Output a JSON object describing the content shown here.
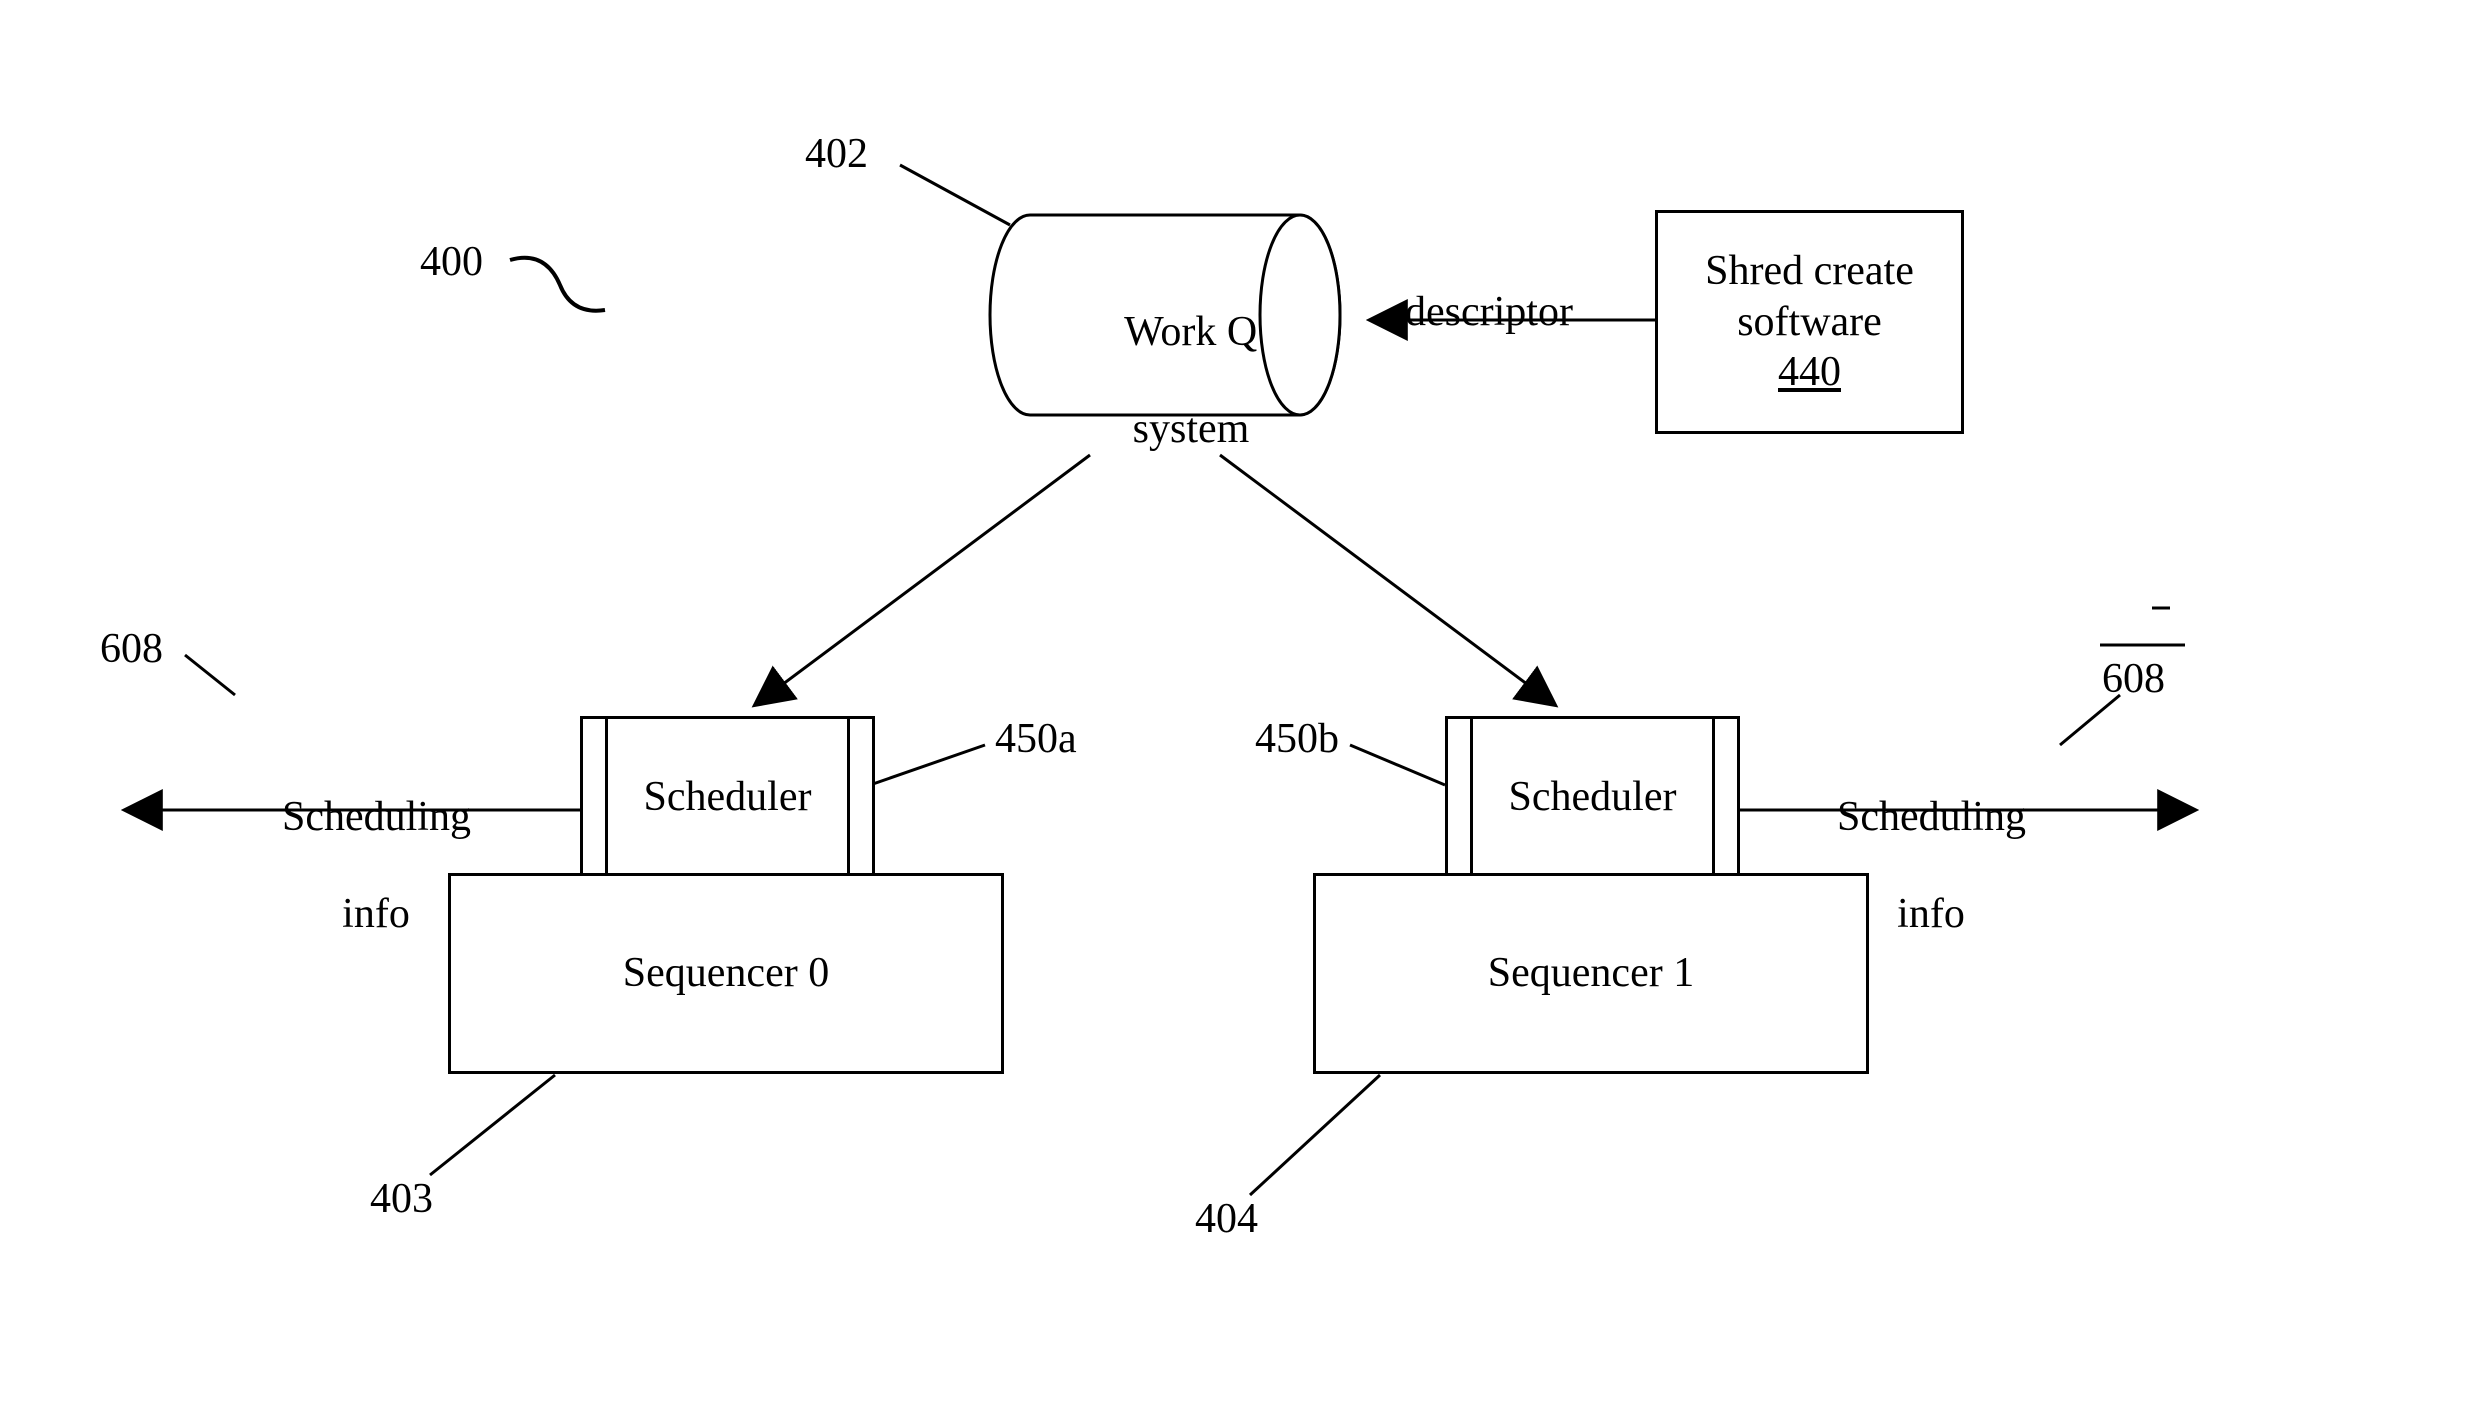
{
  "refs": {
    "fig400": "400",
    "workq_ref": "402",
    "seq0_ref": "403",
    "seq1_ref": "404",
    "shred_ref_underline": "440",
    "sched_a_ref": "450a",
    "sched_b_ref": "450b",
    "out_left_ref": "608",
    "out_right_ref": "608"
  },
  "workq": {
    "line1": "Work Q",
    "line2": "system"
  },
  "shred": {
    "line1": "Shred create",
    "line2": "software"
  },
  "descriptor": "descriptor",
  "scheduler_a": "Scheduler",
  "scheduler_b": "Scheduler",
  "sequencer0": "Sequencer 0",
  "sequencer1": "Sequencer 1",
  "sched_info_left": {
    "line1": "Scheduling",
    "line2": "info"
  },
  "sched_info_right": {
    "line1": "Scheduling",
    "line2": "info"
  }
}
